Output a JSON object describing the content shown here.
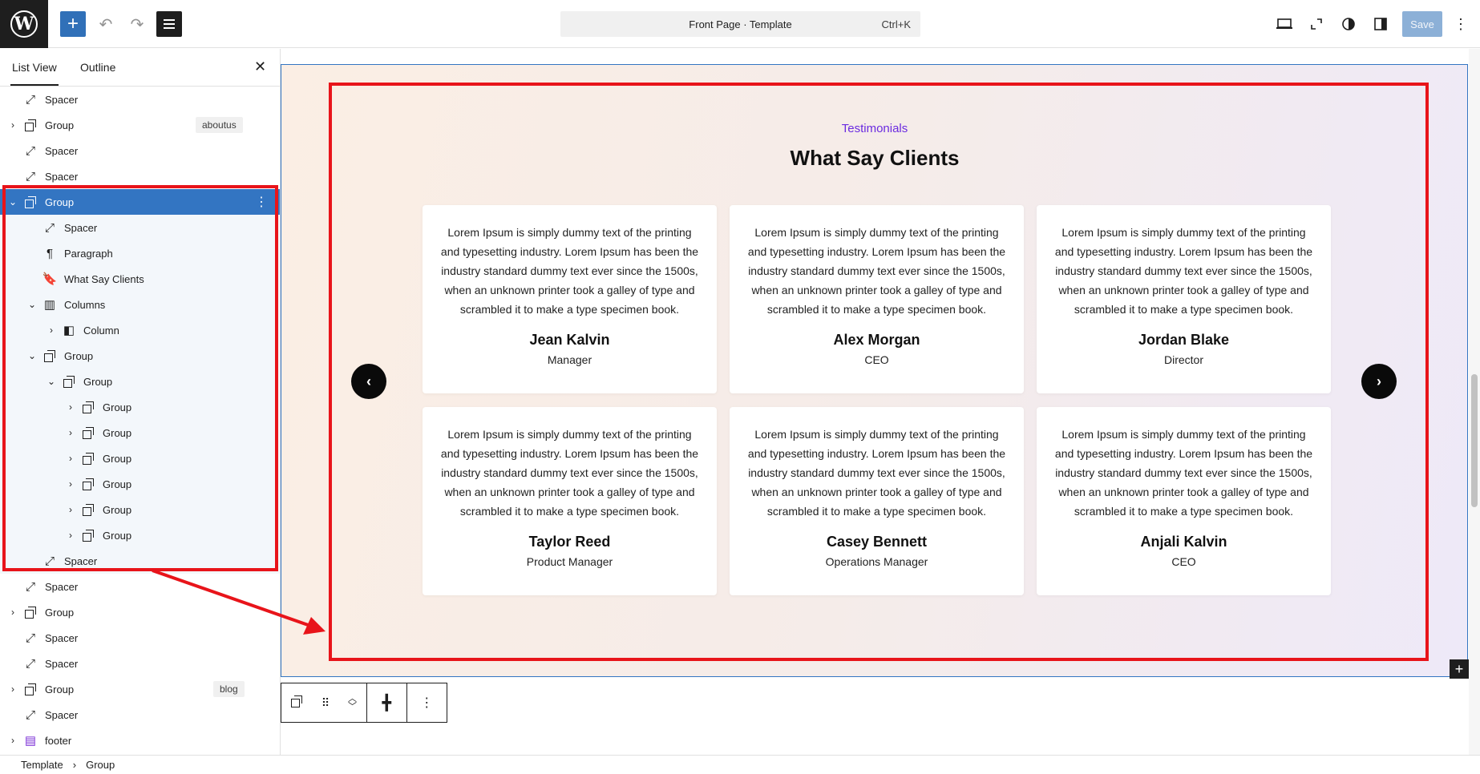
{
  "topbar": {
    "add_icon": "plus-icon",
    "command_title": "Front Page · Template",
    "command_shortcut": "Ctrl+K",
    "save_label": "Save"
  },
  "sidebar": {
    "tabs": [
      "List View",
      "Outline"
    ],
    "rows": [
      {
        "label": "Spacer",
        "icon": "spacer-icon",
        "depth": 0,
        "expand": "none"
      },
      {
        "label": "Group",
        "icon": "group-icon",
        "depth": 0,
        "expand": "collapsed",
        "badge": "aboutus"
      },
      {
        "label": "Spacer",
        "icon": "spacer-icon",
        "depth": 0,
        "expand": "none"
      },
      {
        "label": "Spacer",
        "icon": "spacer-icon",
        "depth": 0,
        "expand": "none"
      },
      {
        "label": "Group",
        "icon": "group-icon",
        "depth": 0,
        "expand": "expanded",
        "selected": true
      },
      {
        "label": "Spacer",
        "icon": "spacer-icon",
        "depth": 1,
        "expand": "none"
      },
      {
        "label": "Paragraph",
        "icon": "paragraph-icon",
        "depth": 1,
        "expand": "none"
      },
      {
        "label": "What Say Clients",
        "icon": "heading-icon",
        "depth": 1,
        "expand": "none"
      },
      {
        "label": "Columns",
        "icon": "columns-icon",
        "depth": 1,
        "expand": "expanded"
      },
      {
        "label": "Column",
        "icon": "column-icon",
        "depth": 2,
        "expand": "collapsed"
      },
      {
        "label": "Group",
        "icon": "group-icon",
        "depth": 1,
        "expand": "expanded"
      },
      {
        "label": "Group",
        "icon": "group-icon",
        "depth": 2,
        "expand": "expanded"
      },
      {
        "label": "Group",
        "icon": "group-icon",
        "depth": 3,
        "expand": "collapsed"
      },
      {
        "label": "Group",
        "icon": "group-icon",
        "depth": 3,
        "expand": "collapsed"
      },
      {
        "label": "Group",
        "icon": "group-icon",
        "depth": 3,
        "expand": "collapsed"
      },
      {
        "label": "Group",
        "icon": "group-icon",
        "depth": 3,
        "expand": "collapsed"
      },
      {
        "label": "Group",
        "icon": "group-icon",
        "depth": 3,
        "expand": "collapsed"
      },
      {
        "label": "Group",
        "icon": "group-icon",
        "depth": 3,
        "expand": "collapsed"
      },
      {
        "label": "Spacer",
        "icon": "spacer-icon",
        "depth": 1,
        "expand": "none"
      },
      {
        "label": "Spacer",
        "icon": "spacer-icon",
        "depth": 0,
        "expand": "none"
      },
      {
        "label": "Group",
        "icon": "group-icon",
        "depth": 0,
        "expand": "collapsed"
      },
      {
        "label": "Spacer",
        "icon": "spacer-icon",
        "depth": 0,
        "expand": "none"
      },
      {
        "label": "Spacer",
        "icon": "spacer-icon",
        "depth": 0,
        "expand": "none"
      },
      {
        "label": "Group",
        "icon": "group-icon",
        "depth": 0,
        "expand": "collapsed",
        "badge": "blog"
      },
      {
        "label": "Spacer",
        "icon": "spacer-icon",
        "depth": 0,
        "expand": "none"
      },
      {
        "label": "footer",
        "icon": "template-part-icon",
        "depth": 0,
        "expand": "collapsed"
      }
    ]
  },
  "section": {
    "eyebrow": "Testimonials",
    "heading": "What Say Clients",
    "eyebrow_color": "#6b2be0",
    "testimonials": [
      {
        "quote": "Lorem Ipsum is simply dummy text of the printing and typesetting industry. Lorem Ipsum has been the industry standard dummy text ever since the 1500s, when an unknown printer took a galley of type and scrambled it to make a type specimen book.",
        "name": "Jean Kalvin",
        "role": "Manager"
      },
      {
        "quote": "Lorem Ipsum is simply dummy text of the printing and typesetting industry. Lorem Ipsum has been the industry standard dummy text ever since the 1500s, when an unknown printer took a galley of type and scrambled it to make a type specimen book.",
        "name": "Alex Morgan",
        "role": "CEO"
      },
      {
        "quote": "Lorem Ipsum is simply dummy text of the printing and typesetting industry. Lorem Ipsum has been the industry standard dummy text ever since the 1500s, when an unknown printer took a galley of type and scrambled it to make a type specimen book.",
        "name": "Jordan Blake",
        "role": "Director"
      },
      {
        "quote": "Lorem Ipsum is simply dummy text of the printing and typesetting industry. Lorem Ipsum has been the industry standard dummy text ever since the 1500s, when an unknown printer took a galley of type and scrambled it to make a type specimen book.",
        "name": "Taylor Reed",
        "role": "Product Manager"
      },
      {
        "quote": "Lorem Ipsum is simply dummy text of the printing and typesetting industry. Lorem Ipsum has been the industry standard dummy text ever since the 1500s, when an unknown printer took a galley of type and scrambled it to make a type specimen book.",
        "name": "Casey Bennett",
        "role": "Operations Manager"
      },
      {
        "quote": "Lorem Ipsum is simply dummy text of the printing and typesetting industry. Lorem Ipsum has been the industry standard dummy text ever since the 1500s, when an unknown printer took a galley of type and scrambled it to make a type specimen book.",
        "name": "Anjali Kalvin",
        "role": "CEO"
      }
    ]
  },
  "breadcrumb": [
    "Template",
    "Group"
  ],
  "colors": {
    "accent": "#3375c2",
    "annotation_red": "#e8141a"
  }
}
